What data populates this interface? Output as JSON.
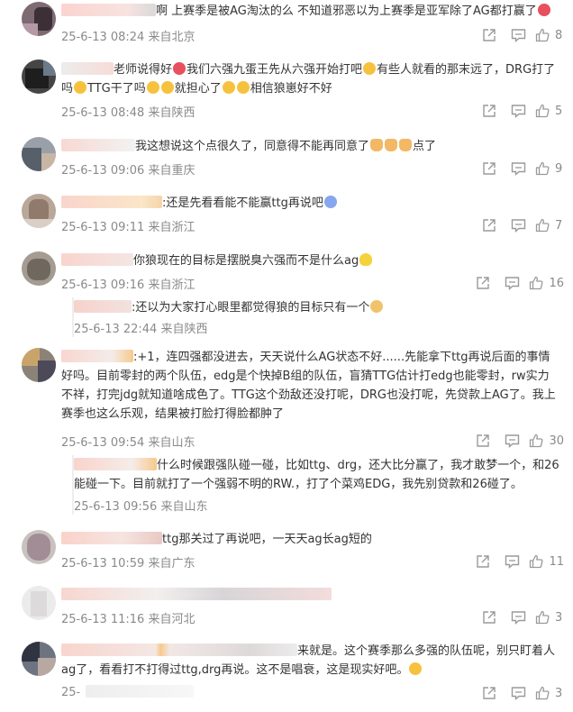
{
  "comments": [
    {
      "text": "啊 上赛季是被AG淘汰的么 不知道邪恶以为上赛季是亚军除了AG都打赢了",
      "time": "25-6-13 08:24",
      "location": "来自北京",
      "likes": "8"
    },
    {
      "text_a": "老师说得好",
      "text_b": "我们六强九蛋王先从六强开始打吧",
      "text_c": "有些人就看的那末远了，DRG打了吗",
      "text_d": "TTG干了吗",
      "text_e": "就担心了",
      "text_f": "相信狼崽好不好",
      "time": "25-6-13 08:48",
      "location": "来自陕西",
      "likes": "5"
    },
    {
      "text": "我这想说这个点很久了，同意得不能再同意了",
      "text_tail": "点了",
      "time": "25-6-13 09:06",
      "location": "来自重庆",
      "likes": "9"
    },
    {
      "text": ":还是先看看能不能赢ttg再说吧",
      "time": "25-6-13 09:11",
      "location": "来自浙江",
      "likes": "7"
    },
    {
      "text": "你狼现在的目标是摆脱臭六强而不是什么ag",
      "time": "25-6-13 09:16",
      "location": "来自浙江",
      "likes": "16"
    },
    {
      "text": ":还以为大家打心眼里都觉得狼的目标只有一个",
      "time": "25-6-13 22:44",
      "location": "来自陕西",
      "likes": ""
    },
    {
      "text": ":+1，连四强都没进去，天天说什么AG状态不好......先能拿下ttg再说后面的事情好吗。目前零封的两个队伍，edg是个快掉B组的队伍，盲猜TTG估计打edg也能零封，rw实力不祥，打完jdg就知道啥成色了。TTG这个劲敌还没打呢，DRG也没打呢，先贷款上AG了。我上赛季也这么乐观，结果被打脸打得脸都肿了",
      "time": "25-6-13 09:54",
      "location": "来自山东",
      "likes": "30"
    },
    {
      "text": "什么时候跟强队碰一碰，比如ttg、drg，还大比分赢了，我才敢梦一个，和26能碰一下。目前就打了一个强弱不明的RW.，打了个菜鸡EDG，我先别贷款和26碰了。",
      "time": "25-6-13 09:56",
      "location": "来自山东",
      "likes": ""
    },
    {
      "text": "ttg那关过了再说吧，一天天ag长ag短的",
      "time": "25-6-13 10:59",
      "location": "来自广东",
      "likes": "11"
    },
    {
      "text": "",
      "time": "25-6-13 11:16",
      "location": "来自河北",
      "likes": "3"
    },
    {
      "text": "来就是。这个赛季那么多强的队伍呢，别只盯着人ag了，看看打不打得过ttg,drg再说。这不是唱衰，这是现实好吧。",
      "time": "25-",
      "location": "",
      "likes": "3"
    }
  ],
  "colors": {
    "meta": "#8a8a8a",
    "text": "#333333",
    "icon": "#9a9a9a"
  },
  "icons": [
    "share-icon",
    "comment-icon",
    "like-icon"
  ]
}
